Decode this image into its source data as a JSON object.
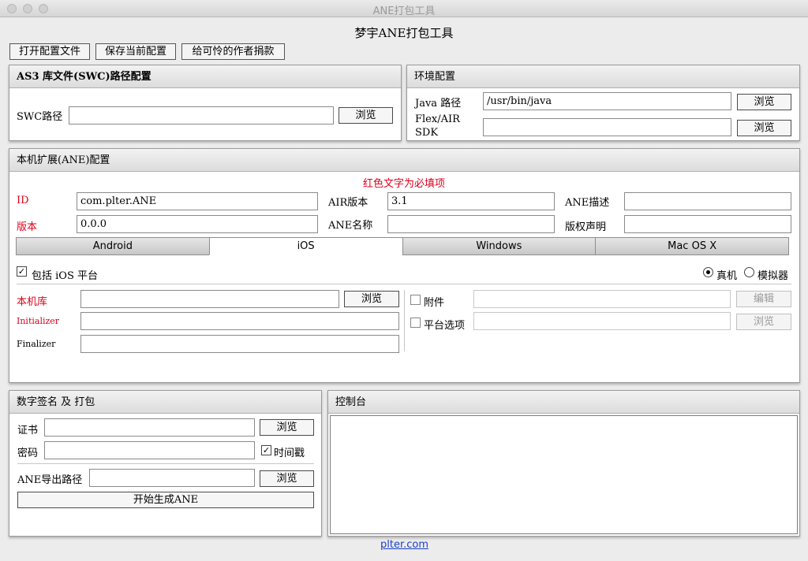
{
  "window": {
    "title": "ANE打包工具"
  },
  "app": {
    "title": "梦宇ANE打包工具"
  },
  "toolbar": {
    "open_config": "打开配置文件",
    "save_config": "保存当前配置",
    "donate": "给可怜的作者捐款"
  },
  "swc_panel": {
    "title": "AS3 库文件(SWC)路径配置",
    "path_label": "SWC路径",
    "path_value": "",
    "browse": "浏览"
  },
  "env_panel": {
    "title": "环境配置",
    "java_label": "Java 路径",
    "java_value": "/usr/bin/java",
    "java_browse": "浏览",
    "sdk_label_1": "Flex/AIR",
    "sdk_label_2": "SDK",
    "sdk_value": "",
    "sdk_browse": "浏览"
  },
  "ane_panel": {
    "title": "本机扩展(ANE)配置",
    "required_note": "红色文字为必填项",
    "id_label": "ID",
    "id_value": "com.plter.ANE",
    "version_label": "版本",
    "version_value": "0.0.0",
    "air_version_label": "AIR版本",
    "air_version_value": "3.1",
    "ane_name_label": "ANE名称",
    "ane_name_value": "",
    "ane_desc_label": "ANE描述",
    "ane_desc_value": "",
    "copyright_label": "版权声明",
    "copyright_value": "",
    "tabs": [
      "Android",
      "iOS",
      "Windows",
      "Mac OS X"
    ],
    "active_tab": "iOS",
    "include_platform": "包括 iOS 平台",
    "include_checked": true,
    "device_label": "真机",
    "simulator_label": "模拟器",
    "native_lib_label": "本机库",
    "native_lib_value": "",
    "native_lib_browse": "浏览",
    "initializer_label": "Initializer",
    "initializer_value": "",
    "finalizer_label": "Finalizer",
    "finalizer_value": "",
    "attachment_label": "附件",
    "attachment_edit": "编辑",
    "platform_options_label": "平台选项",
    "platform_options_browse": "浏览"
  },
  "sign_panel": {
    "title": "数字签名 及 打包",
    "cert_label": "证书",
    "cert_browse": "浏览",
    "password_label": "密码",
    "timestamp_label": "时间戳",
    "timestamp_checked": true,
    "export_label": "ANE导出路径",
    "export_browse": "浏览",
    "generate": "开始生成ANE"
  },
  "console_panel": {
    "title": "控制台"
  },
  "footer": {
    "link": "plter.com"
  }
}
